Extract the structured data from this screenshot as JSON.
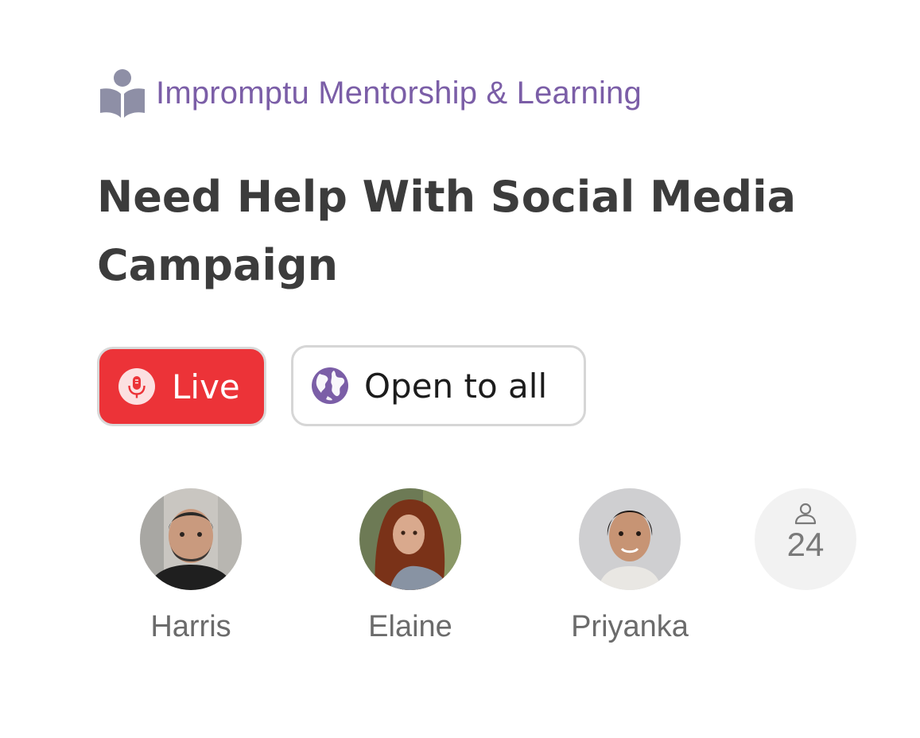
{
  "session": {
    "category": "Impromptu Mentorship & Learning",
    "category_icon": "reading-person-icon",
    "title": "Need Help With Social Media Campaign",
    "live_label": "Live",
    "live_icon": "microphone-icon",
    "access_label": "Open to all",
    "access_icon": "globe-icon"
  },
  "participants": [
    {
      "name": "Harris",
      "avatar": "avatar-photo"
    },
    {
      "name": "Elaine",
      "avatar": "avatar-photo"
    },
    {
      "name": "Priyanka",
      "avatar": "avatar-photo"
    }
  ],
  "attendees": {
    "count": "24",
    "icon": "person-icon"
  },
  "colors": {
    "accent_purple": "#7b5ea7",
    "live_red": "#ec3338",
    "title_text": "#3c3c3c",
    "name_text": "#6b6b6b"
  }
}
